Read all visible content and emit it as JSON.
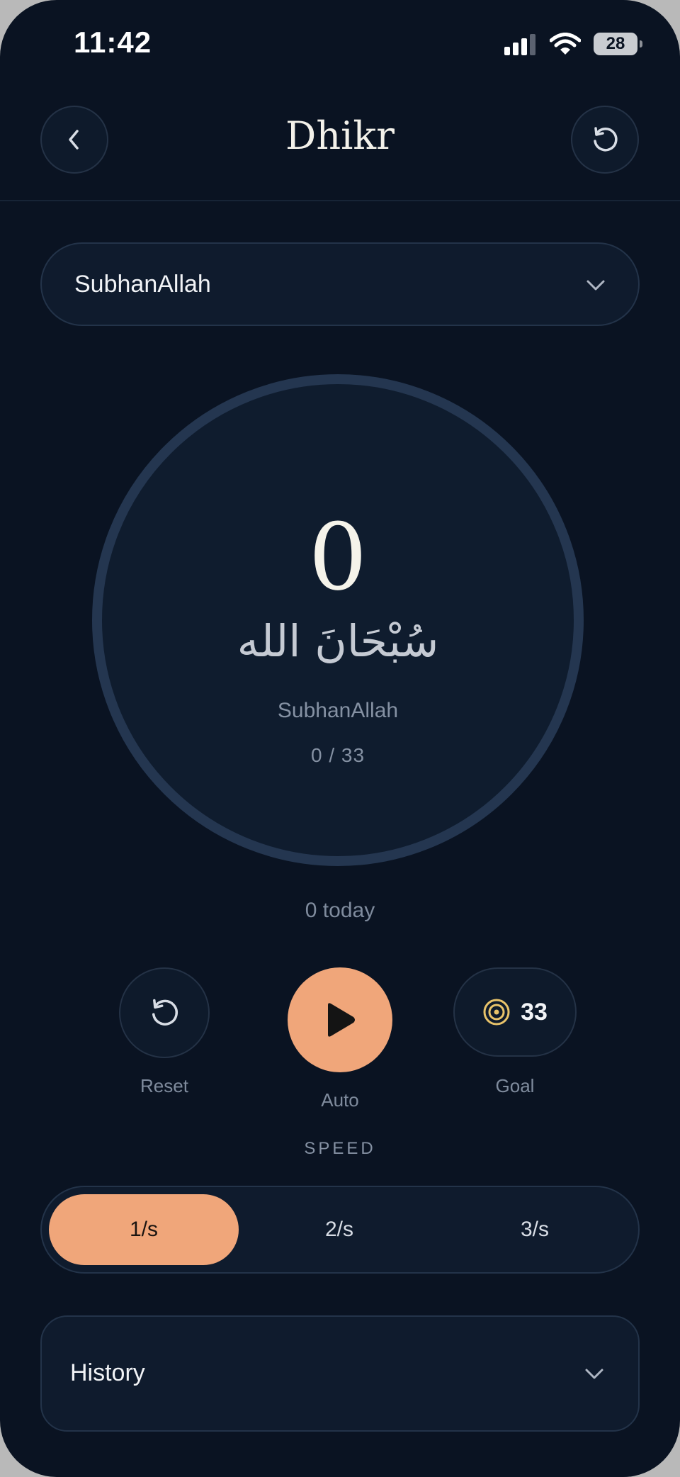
{
  "status_bar": {
    "time": "11:42",
    "battery": "28"
  },
  "header": {
    "title": "Dhikr"
  },
  "selector": {
    "value": "SubhanAllah"
  },
  "counter": {
    "count": "0",
    "arabic": "سُبْحَانَ الله",
    "transliteration": "SubhanAllah",
    "progress": "0 / 33"
  },
  "today_text": "0 today",
  "controls": {
    "reset_label": "Reset",
    "auto_label": "Auto",
    "goal_label": "Goal",
    "goal_value": "33"
  },
  "speed": {
    "title": "SPEED",
    "options": [
      "1/s",
      "2/s",
      "3/s"
    ],
    "selected": "1/s"
  },
  "history": {
    "label": "History"
  },
  "colors": {
    "accent": "#f0a67a",
    "background": "#0a1322",
    "goal_icon": "#e8c36a"
  },
  "icons": [
    "chevron-left-icon",
    "reset-icon",
    "chevron-down-icon",
    "play-icon",
    "target-icon",
    "signal-icon",
    "wifi-icon",
    "battery-icon"
  ]
}
